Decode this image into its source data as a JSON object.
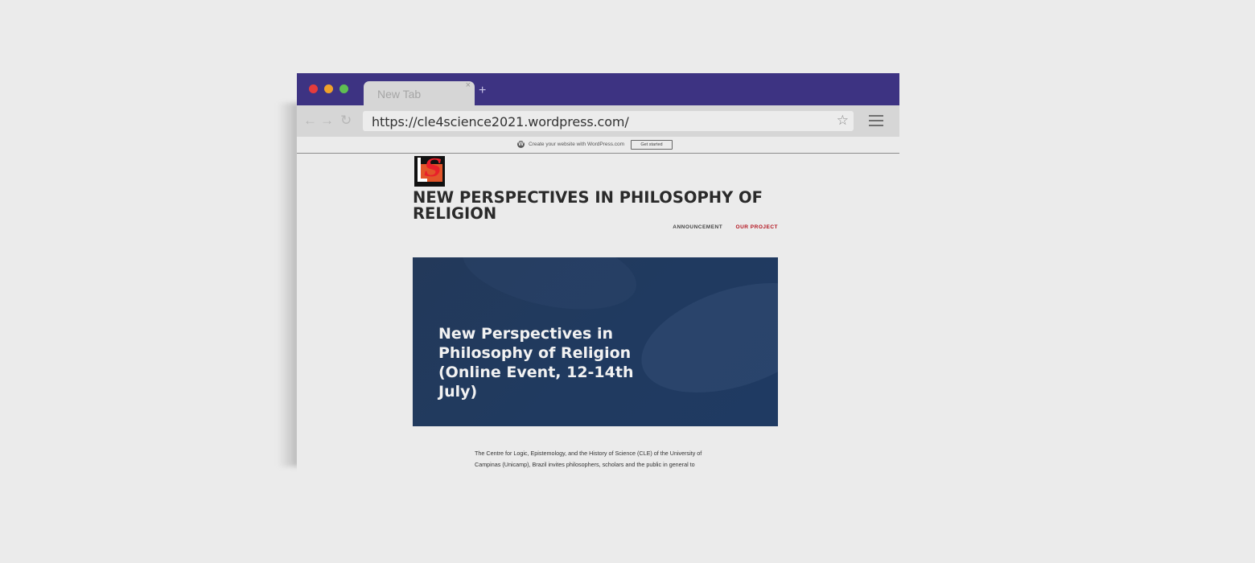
{
  "browser": {
    "tab": {
      "title": "New Tab",
      "close": "×"
    },
    "new_tab": "+",
    "toolbar": {
      "back": "←",
      "forward": "→",
      "reload": "↻",
      "url": "https://cle4science2021.wordpress.com/",
      "bookmark": "☆"
    }
  },
  "wp_bar": {
    "logo": "W",
    "text": "Create your website with WordPress.com",
    "button": "Get started"
  },
  "site": {
    "title": "NEW PERSPECTIVES IN PHILOSOPHY OF RELIGION",
    "nav": [
      {
        "label": "ANNOUNCEMENT",
        "active": false
      },
      {
        "label": "OUR PROJECT",
        "active": true
      }
    ],
    "hero_title": "New Perspectives in Philosophy of Religion (Online Event, 12-14th July)",
    "intro_text": "The Centre for Logic, Epistemology, and the History of Science (CLE) of the University of Campinas (Unicamp), Brazil invites philosophers, scholars and the public in general to"
  },
  "colors": {
    "titlebar": "#3d3382",
    "hero_bg": "#213a5e",
    "nav_active": "#b3121d"
  }
}
